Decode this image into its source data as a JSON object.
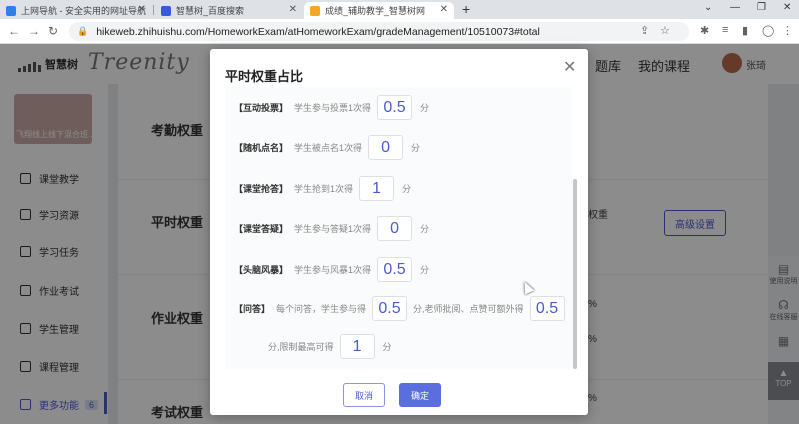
{
  "browser": {
    "tabs": [
      {
        "title": "上网导航 - 安全实用的网址导航",
        "favicon_color": "#2f80ed"
      },
      {
        "title": "智慧树_百度搜索",
        "favicon_color": "#3a59d6"
      },
      {
        "title": "成绩_辅助教学_智慧树网",
        "favicon_color": "#f5a623"
      }
    ],
    "new_tab": "+",
    "url": "hikeweb.zhihuishu.com/HomeworkExam/atHomeworkExam/gradeManagement/10510073#total"
  },
  "site": {
    "logo_text": "智慧树",
    "brand": "Treenity",
    "nav": [
      "题库",
      "我的课程"
    ],
    "username": "张琦"
  },
  "sidebar": {
    "course_caption": "飞翔线上线下混合班...",
    "items": [
      {
        "label": "课堂教学"
      },
      {
        "label": "学习资源"
      },
      {
        "label": "学习任务"
      },
      {
        "label": "作业考试"
      },
      {
        "label": "学生管理"
      },
      {
        "label": "课程管理"
      },
      {
        "label": "更多功能",
        "badge": "6"
      }
    ]
  },
  "main": {
    "sections": [
      "考勤权重",
      "平时权重",
      "作业权重",
      "考试权重"
    ],
    "fragments": {
      "weight_tail": "权重",
      "pct1": "%",
      "pct2": "%",
      "pct3": "%"
    },
    "advanced_button": "高级设置"
  },
  "float_tools": {
    "help": "使用说明",
    "feedback": "在线客服",
    "top": "TOP"
  },
  "modal": {
    "title": "平时权重占比",
    "rows": [
      {
        "name": "【互动投票】",
        "desc": "学生参与投票1次得",
        "value": "0.5",
        "unit": "分"
      },
      {
        "name": "【随机点名】",
        "desc": "学生被点名1次得",
        "value": "0",
        "unit": "分"
      },
      {
        "name": "【课堂抢答】",
        "desc": "学生抢到1次得",
        "value": "1",
        "unit": "分"
      },
      {
        "name": "【课堂答疑】",
        "desc": "学生参与答疑1次得",
        "value": "0",
        "unit": "分"
      },
      {
        "name": "【头脑风暴】",
        "desc": "学生参与风暴1次得",
        "value": "0.5",
        "unit": "分"
      }
    ],
    "qa": {
      "name": "【问答】",
      "desc": "每个问答，学生参与得",
      "value1": "0.5",
      "mid": "分,老师批阅、点赞可额外得",
      "value2": "0.5",
      "line2_prefix": "分,限制最高可得",
      "value3": "1",
      "unit": "分"
    },
    "cancel": "取消",
    "confirm": "确定"
  }
}
